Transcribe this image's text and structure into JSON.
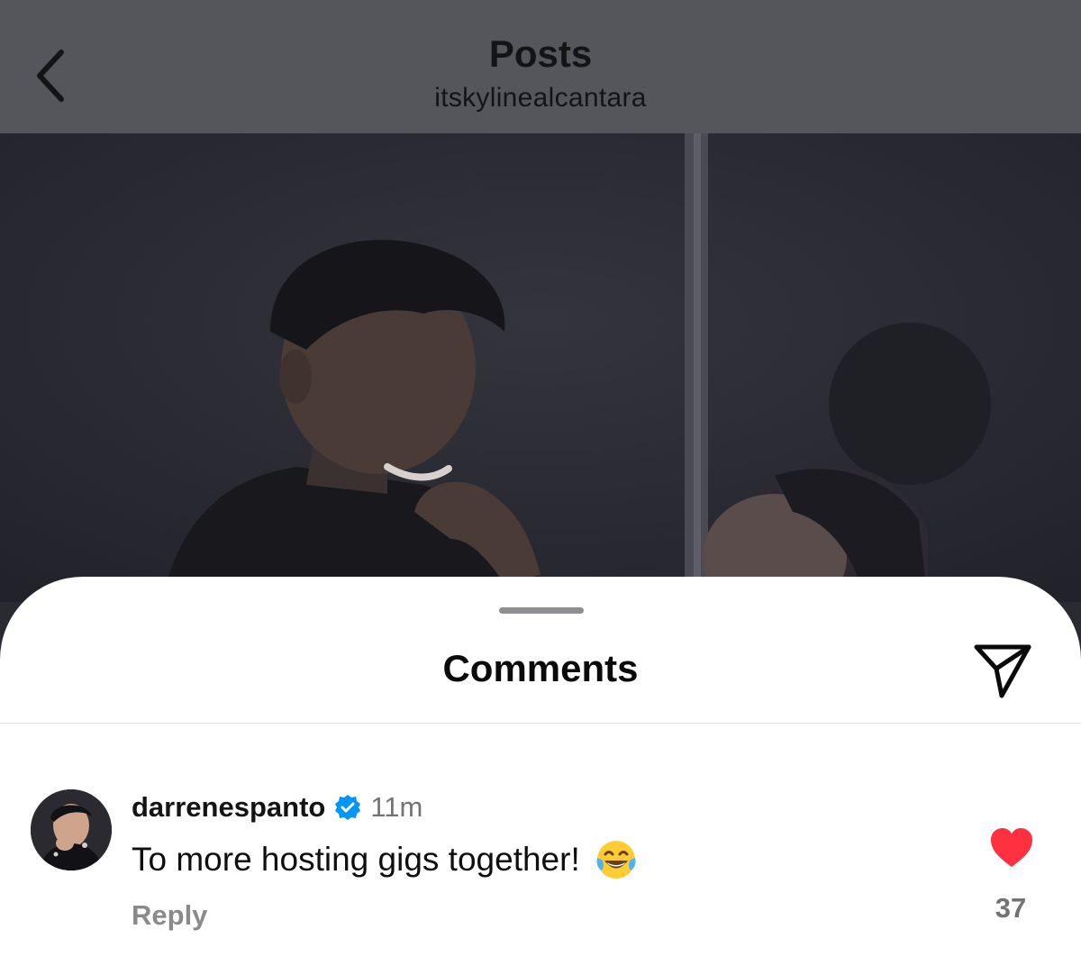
{
  "header": {
    "title": "Posts",
    "subtitle": "itskylinealcantara"
  },
  "photo": {
    "description_icon": "post-photo"
  },
  "comments_sheet": {
    "title": "Comments",
    "share_icon": "paper-plane-icon"
  },
  "comment": {
    "username": "darrenespanto",
    "verified": true,
    "time": "11m",
    "text": "To more hosting gigs together!",
    "emoji_icon": "face-with-tears-of-joy-icon",
    "reply_label": "Reply",
    "liked": true,
    "like_count": "37",
    "like_color": "#ff3040",
    "verified_color": "#0095f6"
  }
}
